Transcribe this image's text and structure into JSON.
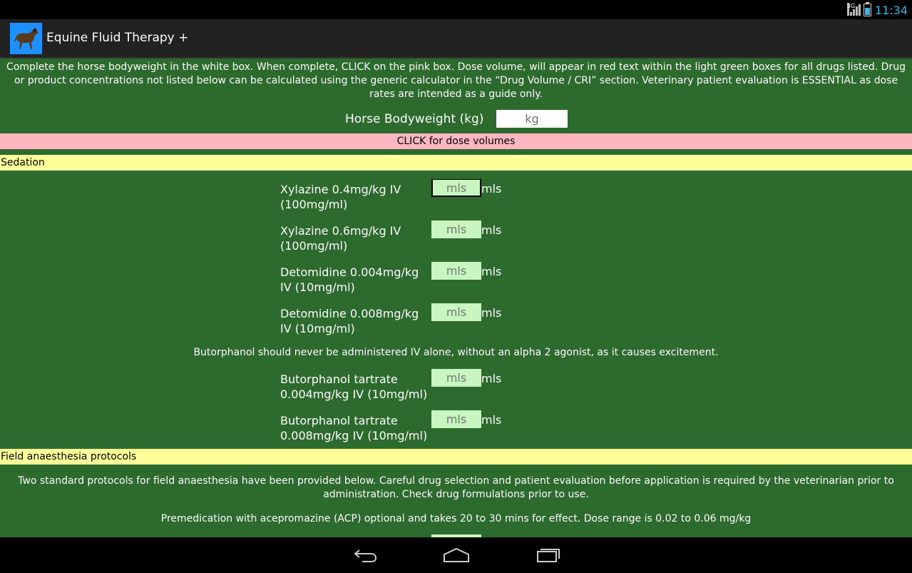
{
  "status": {
    "network": "3G",
    "time": "11:34"
  },
  "app": {
    "title": "Equine Fluid Therapy +"
  },
  "intro": "Complete the horse bodyweight in the white box. When complete, CLICK on the pink box. Dose volume, will appear in red text within the light green boxes for all drugs listed. Drug or product concentrations not listed below can be calculated using the generic calculator in the “Drug Volume / CRI” section. Veterinary patient evaluation is ESSENTIAL as dose rates are intended as a guide only.",
  "bodyweight": {
    "label": "Horse Bodyweight (kg)",
    "placeholder": "kg",
    "value": ""
  },
  "dose_button": "CLICK for dose volumes",
  "sections": {
    "sedation": "Sedation",
    "field": "Field anaesthesia protocols"
  },
  "drugs": [
    {
      "line1": "Xylazine 0.4mg/kg IV",
      "line2": "(100mg/ml)",
      "placeholder": "mls",
      "unit": "mls"
    },
    {
      "line1": "Xylazine 0.6mg/kg IV",
      "line2": "(100mg/ml)",
      "placeholder": "mls",
      "unit": "mls"
    },
    {
      "line1": "Detomidine 0.004mg/kg",
      "line2": "IV (10mg/ml)",
      "placeholder": "mls",
      "unit": "mls"
    },
    {
      "line1": "Detomidine 0.008mg/kg",
      "line2": "IV (10mg/ml)",
      "placeholder": "mls",
      "unit": "mls"
    },
    {
      "line1": "Butorphanol tartrate",
      "line2": "0.004mg/kg IV (10mg/ml)",
      "placeholder": "mls",
      "unit": "mls"
    },
    {
      "line1": "Butorphanol tartrate",
      "line2": "0.008mg/kg IV (10mg/ml)",
      "placeholder": "mls",
      "unit": "mls"
    }
  ],
  "notes": {
    "butorphanol": "Butorphanol should never be administered IV alone, without an alpha 2 agonist, as it causes excitement.",
    "field_intro": "Two standard protocols for field anaesthesia have been provided below. Careful drug selection and patient evaluation before application is required by the veterinarian prior to administration. Check drug formulations prior to use.",
    "premed": "Premedication with acepromazine (ACP) optional and takes 20 to 30 mins for effect. Dose range is 0.02 to 0.06 mg/kg"
  },
  "icons": {
    "app": "horse-icon",
    "back": "back-icon",
    "home": "home-icon",
    "recents": "recents-icon"
  },
  "colors": {
    "background": "#2d6a2d",
    "section": "#ffff99",
    "button": "#ffb6c1",
    "dose_box": "#c8f5c0"
  }
}
